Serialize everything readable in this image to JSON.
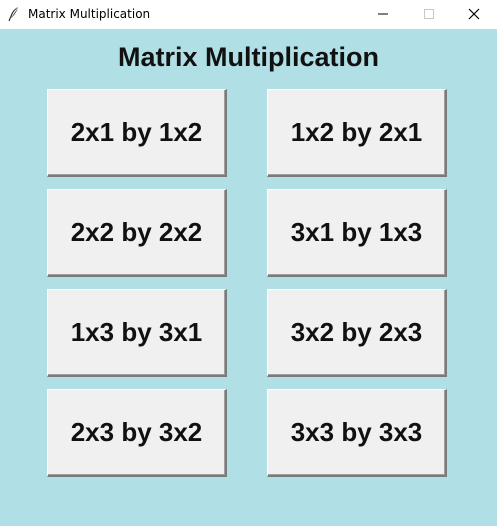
{
  "window": {
    "title": "Matrix Multiplication",
    "app_icon": "feather-icon",
    "controls": {
      "minimize": "minimize-icon",
      "maximize": "maximize-icon",
      "close": "close-icon"
    }
  },
  "main": {
    "heading": "Matrix Multiplication",
    "background_color": "#b0e0e6",
    "buttons": [
      {
        "label": "2x1 by 1x2"
      },
      {
        "label": "1x2 by 2x1"
      },
      {
        "label": "2x2 by 2x2"
      },
      {
        "label": "3x1 by 1x3"
      },
      {
        "label": "1x3 by 3x1"
      },
      {
        "label": "3x2 by 2x3"
      },
      {
        "label": "2x3 by 3x2"
      },
      {
        "label": "3x3 by 3x3"
      }
    ]
  }
}
